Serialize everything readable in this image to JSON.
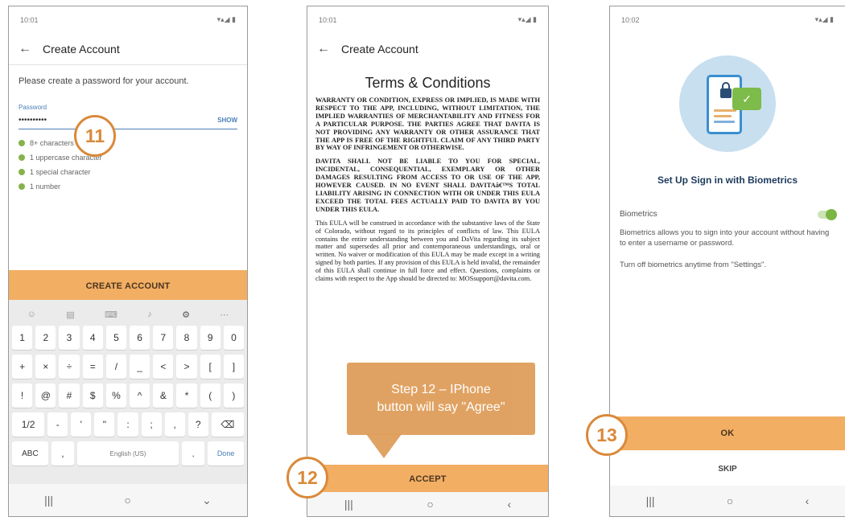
{
  "phone1": {
    "status_time": "10:01",
    "title": "Create Account",
    "prompt": "Please create a password for your account.",
    "password_label": "Password",
    "password_value": "••••••••••",
    "show_label": "SHOW",
    "rules": [
      "8+ characters long",
      "1 uppercase character",
      "1 special character",
      "1 number"
    ],
    "create_button": "CREATE ACCOUNT",
    "step_badge": "11",
    "keyboard": {
      "row1": [
        "1",
        "2",
        "3",
        "4",
        "5",
        "6",
        "7",
        "8",
        "9",
        "0"
      ],
      "row2": [
        "+",
        "×",
        "÷",
        "=",
        "/",
        "_",
        "<",
        ">",
        "[",
        "]"
      ],
      "row3": [
        "!",
        "@",
        "#",
        "$",
        "%",
        "^",
        "&",
        "*",
        "(",
        ")"
      ],
      "row4": [
        "1/2",
        "-",
        "'",
        "\"",
        ":",
        ";",
        ",",
        "?",
        "⌫"
      ],
      "row5": [
        "ABC",
        ",",
        "English (US)",
        ".",
        "Done"
      ]
    }
  },
  "phone2": {
    "status_time": "10:01",
    "title": "Create Account",
    "terms_title": "Terms & Conditions",
    "terms_p1": "WARRANTY OR CONDITION, EXPRESS OR IMPLIED, IS MADE WITH RESPECT TO THE APP, INCLUDING, WITHOUT LIMITATION, THE IMPLIED WARRANTIES OF MERCHANTABILITY AND FITNESS FOR A PARTICULAR PURPOSE. THE PARTIES AGREE THAT DAVITA IS NOT PROVIDING ANY WARRANTY OR OTHER ASSURANCE THAT THE APP IS FREE OF THE RIGHTFUL CLAIM OF ANY THIRD PARTY BY WAY OF INFRINGEMENT OR OTHERWISE.",
    "terms_p2": "DAVITA SHALL NOT BE LIABLE TO YOU FOR SPECIAL, INCIDENTAL, CONSEQUENTIAL, EXEMPLARY OR OTHER DAMAGES RESULTING FROM ACCESS TO OR USE OF THE APP, HOWEVER CAUSED. IN NO EVENT SHALL DAVITAâ€™S TOTAL LIABILITY ARISING IN CONNECTION WITH OR UNDER THIS EULA EXCEED THE TOTAL FEES ACTUALLY PAID TO DAVITA BY YOU UNDER THIS EULA.",
    "terms_p3": "This EULA will be construed in accordance with the substantive laws of the State of Colorado, without regard to its principles of conflicts of law. This EULA contains the entire understanding between you and DaVita regarding its subject matter and supersedes all prior and contemporaneous understandings, oral or written. No waiver or modification of this EULA may be made except in a writing signed by both parties. If any provision of this EULA is held invalid, the remainder of this EULA shall continue in full force and effect. Questions, complaints or claims with respect to the App should be directed to: MOSsupport@davita.com.",
    "accept_button": "ACCEPT",
    "step_badge": "12",
    "callout_line1": "Step 12 – IPhone",
    "callout_line2": "button will say \"Agree\""
  },
  "phone3": {
    "status_time": "10:02",
    "title": "Set Up Sign in with Biometrics",
    "biometrics_label": "Biometrics",
    "desc1": "Biometrics allows you to sign into your account without having to enter a username or password.",
    "desc2": "Turn off biometrics anytime from \"Settings\".",
    "ok_button": "OK",
    "skip_button": "SKIP",
    "step_badge": "13",
    "biometrics_enabled": true
  },
  "nav": {
    "recent": "|||",
    "home": "○",
    "back": "‹",
    "back2": "⌄"
  },
  "colors": {
    "accent": "#f2ae63",
    "badge": "#d9893a",
    "link": "#4b7fb8",
    "check": "#86b24a"
  }
}
